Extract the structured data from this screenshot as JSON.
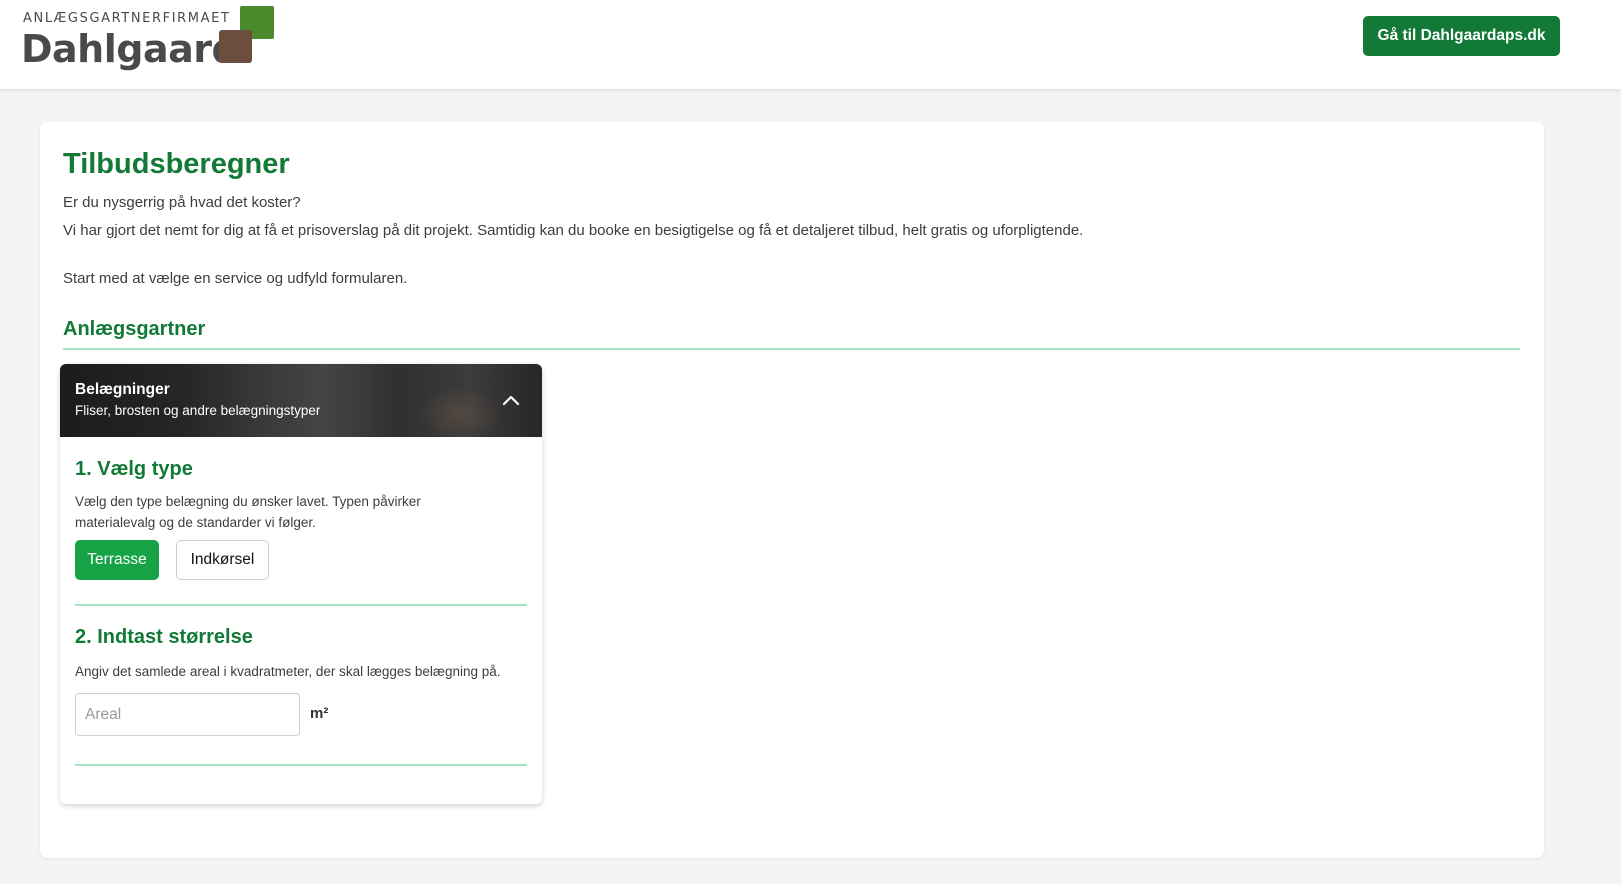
{
  "header": {
    "logo_small": "ANLÆGSGARTNERFIRMAET",
    "logo_big": "Dahlgaard",
    "logo_colors": {
      "green": "#4b8a2d",
      "brown": "#6b4e3e"
    },
    "cta_label": "Gå til Dahlgaardaps.dk"
  },
  "main": {
    "title": "Tilbudsberegner",
    "intro_lines": [
      "Er du nysgerrig på hvad det koster?",
      "Vi har gjort det nemt for dig at få et prisoverslag på dit projekt. Samtidig kan du booke en besigtigelse og få et detaljeret tilbud, helt gratis og uforpligtende.",
      "Start med at vælge en service og udfyld formularen."
    ],
    "section_title": "Anlægsgartner",
    "service": {
      "title": "Belægninger",
      "subtitle": "Fliser, brosten og andre belægningstyper",
      "toggle_icon": "chevron-up-icon",
      "step1": {
        "title": "1. Vælg type",
        "desc": "Vælg den type belægning du ønsker lavet. Typen påvirker materialevalg og de standarder vi følger.",
        "options": [
          "Terrasse",
          "Indkørsel"
        ],
        "selected": "Terrasse"
      },
      "step2": {
        "title": "2. Indtast størrelse",
        "desc": "Angiv det samlede areal i kvadratmeter, der skal lægges belægning på.",
        "input_value": "",
        "input_placeholder": "Areal",
        "unit": "m²"
      }
    }
  },
  "colors": {
    "brand_green": "#127a36",
    "active_green": "#16a345",
    "divider_green": "#a6e3c2",
    "page_bg": "#f4f4f4"
  }
}
